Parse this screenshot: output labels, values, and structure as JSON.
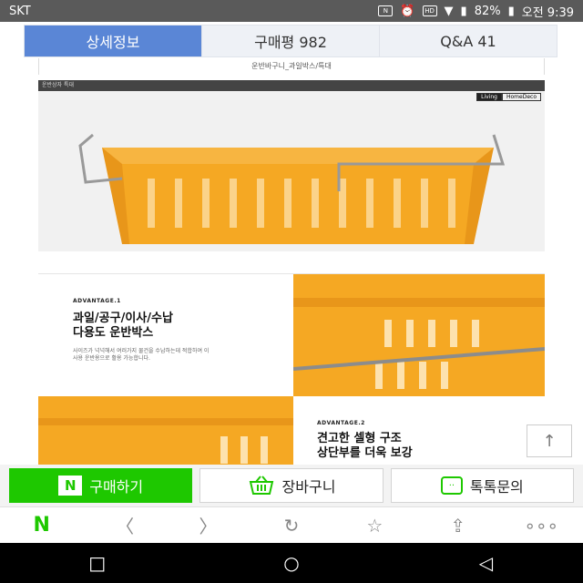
{
  "status_bar": {
    "carrier": "SKT",
    "icons": [
      "nfc-icon",
      "alarm-icon",
      "hd-voice-icon",
      "wifi-icon",
      "signal-icon",
      "battery-icon"
    ],
    "battery": "82%",
    "time": "오전 9:39"
  },
  "tabs": [
    {
      "label": "상세정보",
      "active": true
    },
    {
      "label": "구매평 982",
      "active": false
    },
    {
      "label": "Q&A 41",
      "active": false
    }
  ],
  "product": {
    "caption": "운반바구니_과일박스/특대",
    "section_header": "운반상자 특대",
    "tags": [
      "Living",
      "HomeDeco"
    ],
    "advantage1": {
      "label": "ADVANTAGE.1",
      "title_lines": [
        "과일/공구/이사/수납",
        "다용도 운반박스"
      ],
      "body": "사이즈가 넉넉해서 여러가지 물건을 수납하는데 적합하여 이사용 운반용으로 활용 가능합니다."
    },
    "advantage2": {
      "label": "ADVANTAGE.2",
      "title_lines": [
        "견고한 셀형 구조",
        "상단부를 더욱 보강"
      ]
    }
  },
  "scroll_top": {
    "icon": "arrow-up-icon"
  },
  "actions": {
    "buy": "구매하기",
    "cart": "장바구니",
    "talk": "톡톡문의"
  },
  "colors": {
    "tab_active": "#5a86d6",
    "naver_green": "#1ec800",
    "basket_orange": "#f5a823"
  }
}
